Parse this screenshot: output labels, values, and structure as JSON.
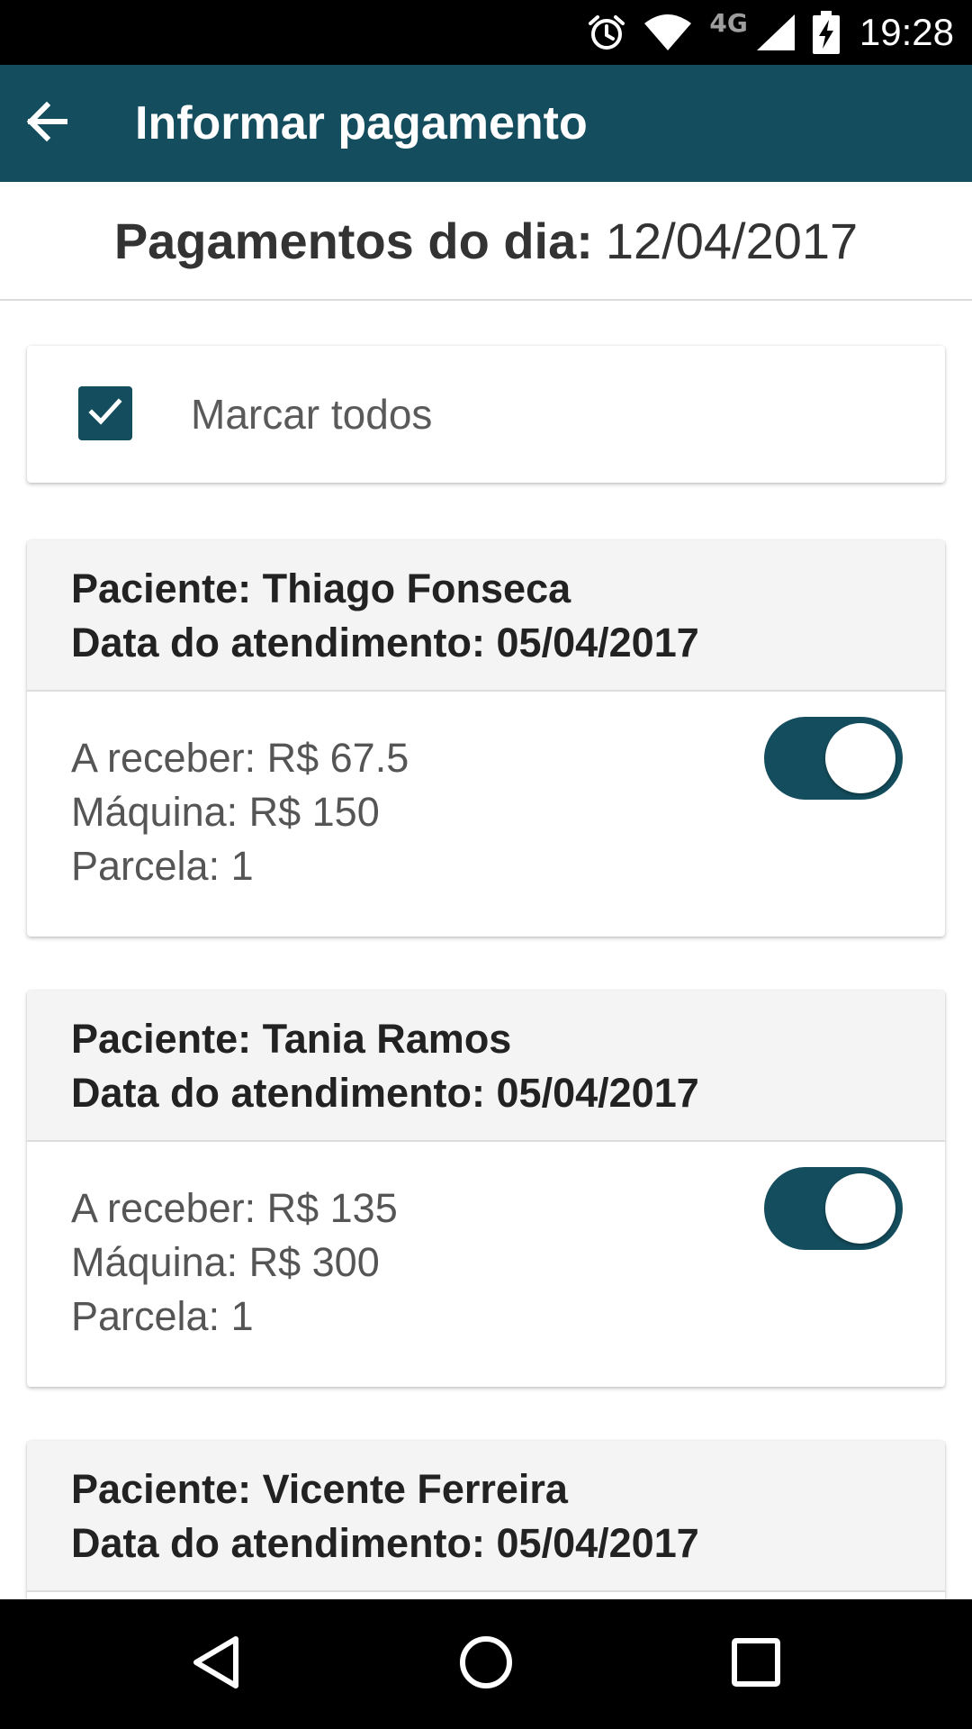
{
  "status_bar": {
    "network": "4G",
    "time": "19:28",
    "icons": [
      "alarm-icon",
      "wifi-icon",
      "signal-icon",
      "battery-charging-icon"
    ]
  },
  "app_bar": {
    "back_icon": "arrow-back-icon",
    "title": "Informar pagamento",
    "color": "#144e5e"
  },
  "day_header": {
    "label": "Pagamentos do dia:",
    "date": "12/04/2017"
  },
  "mark_all": {
    "checked": true,
    "label": "Marcar todos"
  },
  "payments": [
    {
      "patient": "Paciente: Thiago Fonseca",
      "date": "Data do atendimento: 05/04/2017",
      "to_receive": "A receber: R$ 67.5",
      "machine": "Máquina: R$ 150",
      "installment": "Parcela: 1",
      "toggle_on": true
    },
    {
      "patient": "Paciente: Tania Ramos",
      "date": "Data do atendimento: 05/04/2017",
      "to_receive": "A receber: R$ 135",
      "machine": "Máquina: R$ 300",
      "installment": "Parcela: 1",
      "toggle_on": true
    },
    {
      "patient": "Paciente: Vicente Ferreira",
      "date": "Data do atendimento: 05/04/2017"
    }
  ],
  "nav_bar": {
    "icons": [
      "back-triangle-icon",
      "home-circle-icon",
      "recents-square-icon"
    ]
  }
}
